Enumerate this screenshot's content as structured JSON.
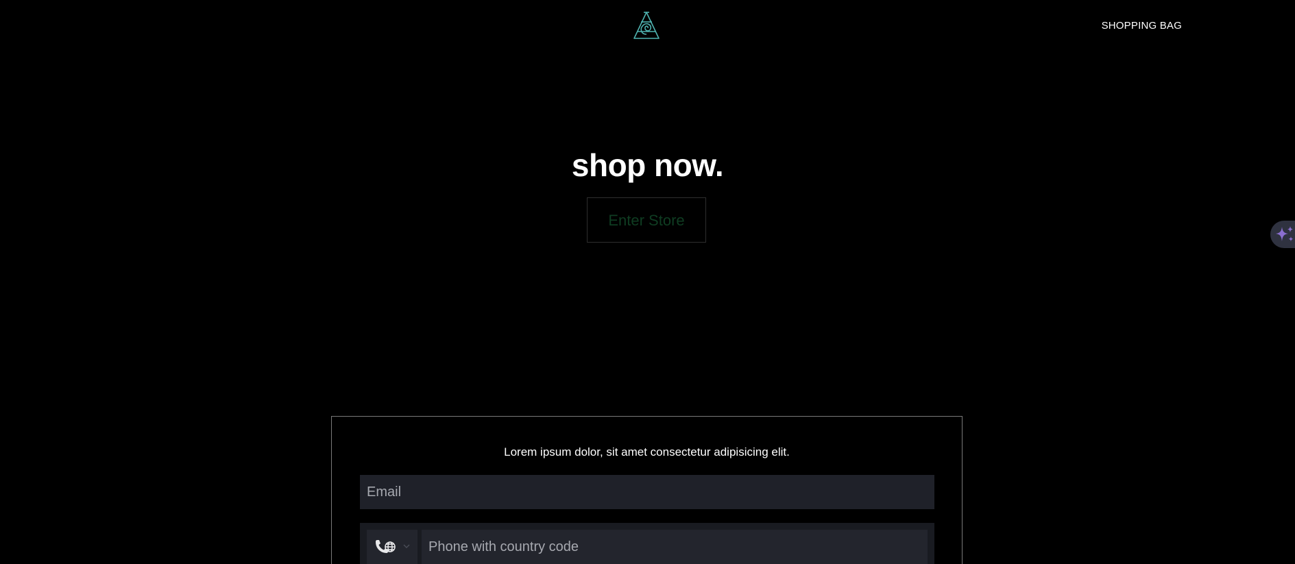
{
  "header": {
    "logo_icon": "cone-spiral-logo-icon",
    "logo_color": "#4fb3b0",
    "bag_label": "SHOPPING BAG"
  },
  "hero": {
    "title": "shop now.",
    "enter_button": "Enter Store"
  },
  "ai_button": {
    "icon": "sparkle-icon",
    "color": "#8b6fd0"
  },
  "signup": {
    "text": "Lorem ipsum dolor, sit amet consectetur adipisicing elit.",
    "email_placeholder": "Email",
    "country_icon": "phone-globe-icon",
    "phone_placeholder": "Phone with country code"
  }
}
